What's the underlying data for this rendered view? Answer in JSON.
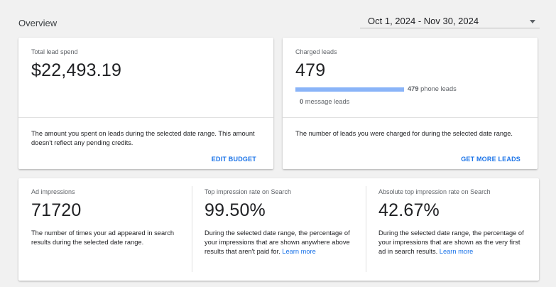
{
  "header": {
    "title": "Overview",
    "date_range": "Oct 1, 2024 - Nov 30, 2024"
  },
  "spend_card": {
    "label": "Total lead spend",
    "value": "$22,493.19",
    "description": "The amount you spent on leads during the selected date range. This amount doesn't reflect any pending credits.",
    "link": "EDIT BUDGET"
  },
  "charged_card": {
    "label": "Charged leads",
    "value": "479",
    "phone_leads_count": "479",
    "phone_leads_label": "phone leads",
    "message_leads_count": "0",
    "message_leads_label": "message leads",
    "description": "The number of leads you were charged for during the selected date range.",
    "link": "GET MORE LEADS"
  },
  "metrics": [
    {
      "label": "Ad impressions",
      "value": "71720",
      "description": "The number of times your ad appeared in search results during the selected date range.",
      "link": ""
    },
    {
      "label": "Top impression rate on Search",
      "value": "99.50%",
      "description": "During the selected date range, the percentage of your impressions that are shown anywhere above results that aren't paid for.",
      "link": "Learn more"
    },
    {
      "label": "Absolute top impression rate on Search",
      "value": "42.67%",
      "description": "During the selected date range, the percentage of your impressions that are shown as the very first ad in search results.",
      "link": "Learn more"
    }
  ],
  "colors": {
    "accent": "#1a73e8",
    "bar": "#8ab4f8",
    "background": "#f1f1f1"
  }
}
